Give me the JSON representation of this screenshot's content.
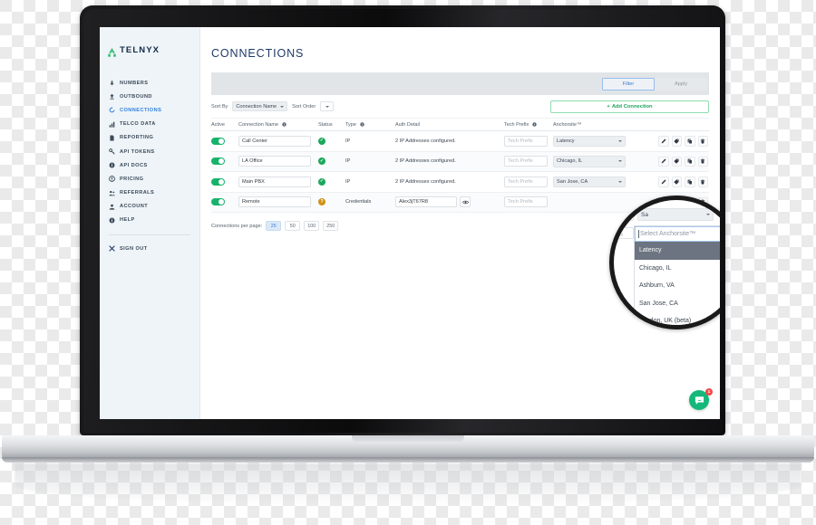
{
  "brand": {
    "name": "TELNYX",
    "logo_color": "#2fbd6e",
    "accent_green": "#22a45d",
    "accent_blue": "#3d7cd4"
  },
  "sidebar": {
    "items": [
      {
        "label": "NUMBERS",
        "icon": "numbers-icon",
        "active": false
      },
      {
        "label": "OUTBOUND",
        "icon": "outbound-icon",
        "active": false
      },
      {
        "label": "CONNECTIONS",
        "icon": "connections-icon",
        "active": true
      },
      {
        "label": "TELCO DATA",
        "icon": "chart-icon",
        "active": false
      },
      {
        "label": "REPORTING",
        "icon": "report-icon",
        "active": false
      },
      {
        "label": "API TOKENS",
        "icon": "key-icon",
        "active": false
      },
      {
        "label": "API DOCS",
        "icon": "info-icon",
        "active": false
      },
      {
        "label": "PRICING",
        "icon": "pricing-icon",
        "active": false
      },
      {
        "label": "REFERRALS",
        "icon": "referrals-icon",
        "active": false
      },
      {
        "label": "ACCOUNT",
        "icon": "account-icon",
        "active": false
      },
      {
        "label": "HELP",
        "icon": "help-icon",
        "active": false
      }
    ],
    "sign_out": {
      "label": "SIGN OUT",
      "icon": "sign-out-icon"
    }
  },
  "header": {
    "title": "CONNECTIONS"
  },
  "filter_bar": {
    "filter_label": "Filter",
    "apply_label": "Apply"
  },
  "sort_bar": {
    "sort_by_label": "Sort By",
    "sort_by_value": "Connection Name",
    "sort_order_label": "Sort Order",
    "sort_order_value": "",
    "add_connection_label": "Add Connection",
    "add_connection_plus": "+"
  },
  "table": {
    "columns": [
      "Active",
      "Connection Name",
      "Status",
      "Type",
      "Auth Detail",
      "Tech Prefix",
      "Anchorsite™"
    ],
    "tech_prefix_placeholder": "Tech Prefix",
    "rows": [
      {
        "active": true,
        "name": "Call Center",
        "status": "ok",
        "status_glyph": "✓",
        "type": "IP",
        "auth_detail": "2 IP Addresses configured.",
        "tech_prefix": "",
        "anchorsite": "Latency",
        "has_eye": false
      },
      {
        "active": true,
        "name": "LA Office",
        "status": "ok",
        "status_glyph": "✓",
        "type": "IP",
        "auth_detail": "2 IP Addresses configured.",
        "tech_prefix": "",
        "anchorsite": "Chicago, IL",
        "has_eye": false
      },
      {
        "active": true,
        "name": "Main PBX",
        "status": "ok",
        "status_glyph": "✓",
        "type": "IP",
        "auth_detail": "2 IP Addresses configured.",
        "tech_prefix": "",
        "anchorsite": "San Jose, CA",
        "has_eye": false
      },
      {
        "active": true,
        "name": "Remote",
        "status": "warn",
        "status_glyph": "?",
        "type": "Credentials",
        "auth_detail": "Alex3jT67R8",
        "tech_prefix": "",
        "anchorsite": "",
        "has_eye": true
      }
    ],
    "actions": [
      {
        "icon": "pencil-icon",
        "name": "edit-connection"
      },
      {
        "icon": "tag-icon",
        "name": "tag-connection"
      },
      {
        "icon": "copy-icon",
        "name": "duplicate-connection"
      },
      {
        "icon": "trash-icon",
        "name": "delete-connection"
      }
    ]
  },
  "pagination": {
    "label": "Connections per page:",
    "options": [
      "25",
      "50",
      "100",
      "250"
    ],
    "selected": "25"
  },
  "magnifier": {
    "prefix_placeholder": "Tech Prefix",
    "collapsed_select_value": "Sa",
    "dropdown_placeholder": "Select Anchorsite™",
    "options": [
      {
        "label": "Latency",
        "highlighted": true
      },
      {
        "label": "Chicago, IL",
        "highlighted": false
      },
      {
        "label": "Ashburn, VA",
        "highlighted": false
      },
      {
        "label": "San Jose, CA",
        "highlighted": false
      },
      {
        "label": "London, UK (beta)",
        "highlighted": false
      }
    ]
  },
  "chat": {
    "badge_count": "1",
    "icon": "chat-bubble-icon"
  }
}
